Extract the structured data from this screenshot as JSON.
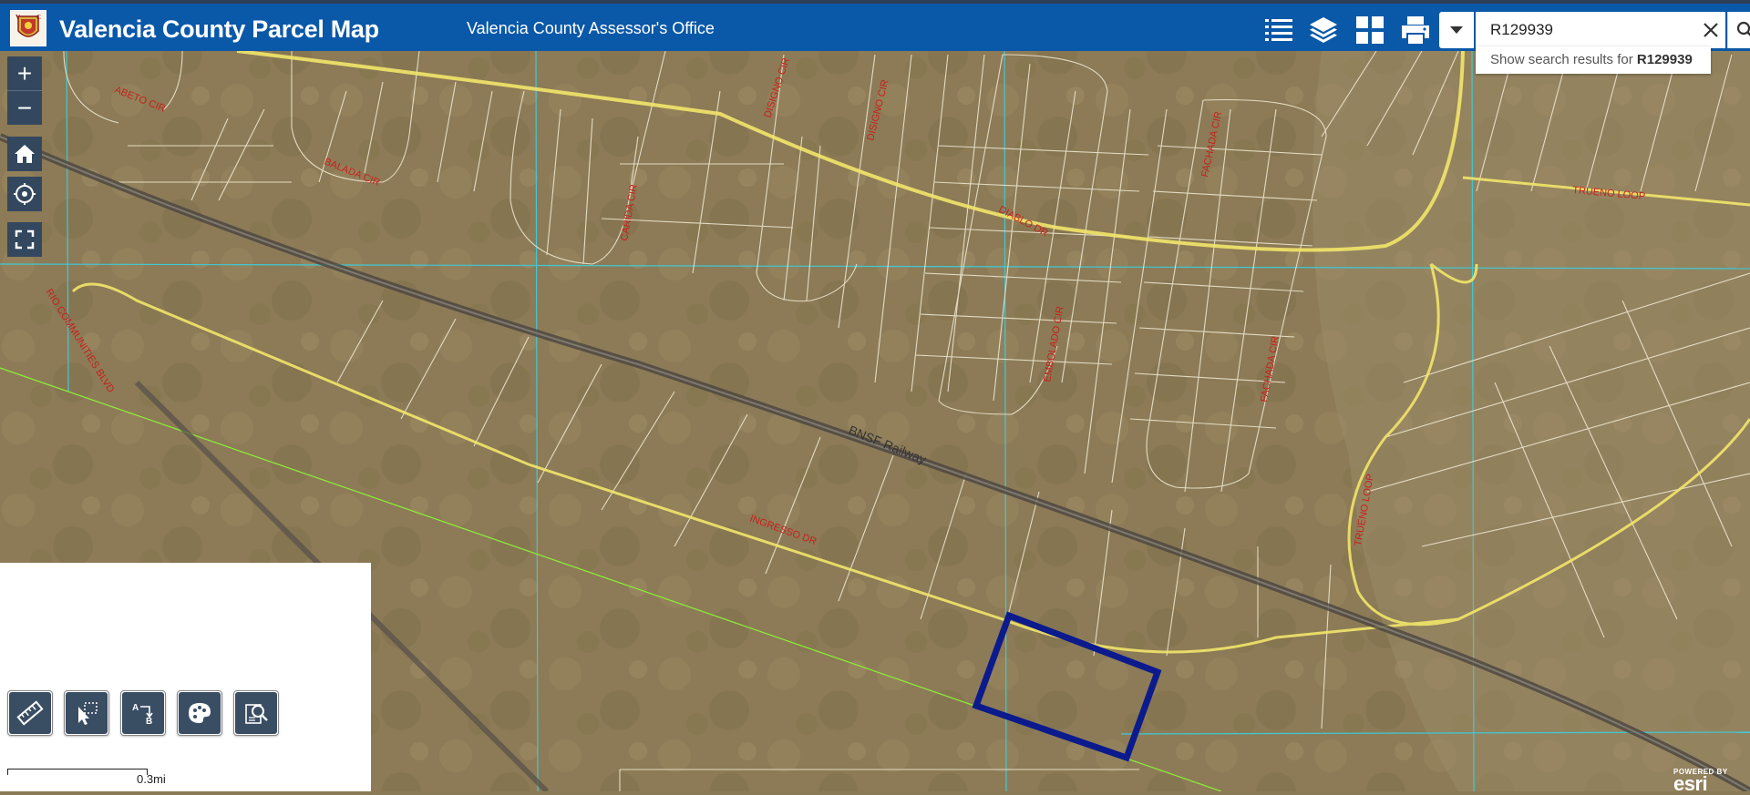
{
  "header": {
    "title": "Valencia County Parcel Map",
    "subtitle": "Valencia County Assessor's Office",
    "buttons": [
      {
        "name": "legend-button",
        "icon": "list-icon"
      },
      {
        "name": "layers-button",
        "icon": "layers-icon"
      },
      {
        "name": "basemap-button",
        "icon": "grid-icon"
      },
      {
        "name": "print-button",
        "icon": "printer-icon"
      }
    ]
  },
  "search": {
    "value": "R129939",
    "suggestion_prefix": "Show search results for ",
    "suggestion_term": "R129939"
  },
  "map": {
    "road_labels": [
      "ABETO CIR",
      "BALADA CIR",
      "DISIGNO CIR",
      "DISIGNO CIR",
      "CARIDA CIR",
      "DIABLO DR",
      "FACHADA CIR",
      "TRUENO LOOP",
      "RIO COMMUNITIES BLVD",
      "EMBOLADO CIR",
      "FACHADA CIR",
      "BNSF Railway",
      "TRUENO LOOP",
      "INGRESSO DR"
    ],
    "colors": {
      "parcel_line": "#f2ecd6",
      "road": "#f2e66a",
      "grid": "#3ec9d8",
      "boundary": "#8bea3a",
      "selected_parcel": "#0b1a8c",
      "header": "#0a58a8",
      "control": "#33485e"
    }
  },
  "controls": {
    "zoom_in": "+",
    "zoom_out": "−",
    "home_icon": "home-icon",
    "locate_icon": "locate-icon",
    "fullscreen_icon": "fullscreen-icon"
  },
  "tools": [
    {
      "name": "measure-tool",
      "icon": "ruler-icon"
    },
    {
      "name": "select-tool",
      "icon": "select-cursor-icon"
    },
    {
      "name": "directions-tool",
      "icon": "a-to-b-icon"
    },
    {
      "name": "draw-tool",
      "icon": "palette-icon"
    },
    {
      "name": "query-tool",
      "icon": "zoom-document-icon"
    }
  ],
  "scale": {
    "label": "0.3mi"
  },
  "attribution": {
    "powered_by": "POWERED BY",
    "brand": "esri"
  }
}
